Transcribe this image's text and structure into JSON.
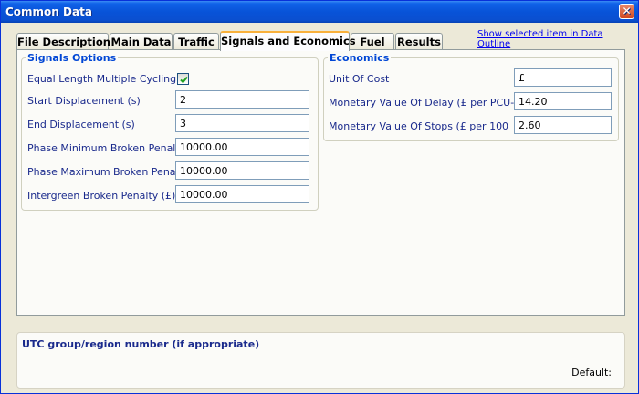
{
  "window": {
    "title": "Common Data",
    "close_glyph": "✕"
  },
  "tabs": [
    {
      "label": "File Description"
    },
    {
      "label": "Main Data"
    },
    {
      "label": "Traffic"
    },
    {
      "label": "Signals and Economics",
      "active": true
    },
    {
      "label": "Fuel"
    },
    {
      "label": "Results"
    }
  ],
  "data_outline_link": "Show selected item in Data Outline",
  "signals": {
    "legend": "Signals Options",
    "equal_length_label": "Equal Length Multiple Cycling",
    "equal_length_checked": true,
    "start_label": "Start Displacement (s)",
    "start_value": "2",
    "end_label": "End Displacement (s)",
    "end_value": "3",
    "phase_min_label": "Phase Minimum Broken Penalty",
    "phase_min_value": "10000.00",
    "phase_max_label": "Phase Maximum Broken Penalty",
    "phase_max_value": "10000.00",
    "intergreen_label": "Intergreen Broken Penalty (£)",
    "intergreen_value": "10000.00"
  },
  "economics": {
    "legend": "Economics",
    "unit_label": "Unit Of Cost",
    "unit_value": "£",
    "delay_label": "Monetary Value Of Delay (£ per PCU-hr)",
    "delay_value": "14.20",
    "stops_label": "Monetary Value Of Stops (£ per 100",
    "stops_value": "2.60"
  },
  "info": {
    "utc_label": "UTC group/region number (if appropriate)",
    "default_label": "Default:"
  },
  "icons": {
    "close": "close-icon",
    "check": "check-icon"
  },
  "colors": {
    "title_blue": "#0853d8",
    "legend_blue": "#0046d5",
    "label_navy": "#1a2a8c",
    "tab_active": "#f9b13c"
  }
}
